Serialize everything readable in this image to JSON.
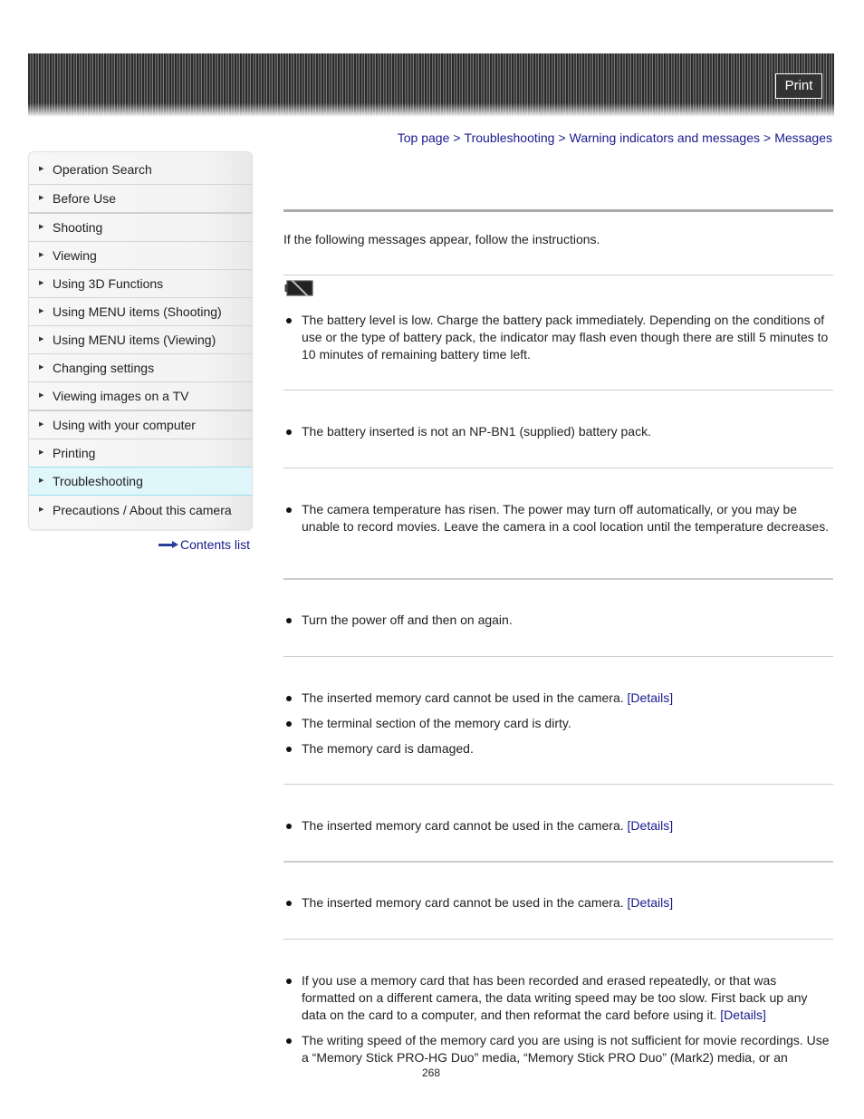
{
  "header": {
    "print_label": "Print"
  },
  "breadcrumb": {
    "items": [
      "Top page",
      "Troubleshooting",
      "Warning indicators and messages",
      "Messages"
    ],
    "separator": ">"
  },
  "sidebar": {
    "items": [
      {
        "label": "Operation Search"
      },
      {
        "label": "Before Use"
      },
      {
        "label": "Shooting"
      },
      {
        "label": "Viewing"
      },
      {
        "label": "Using 3D Functions"
      },
      {
        "label": "Using MENU items (Shooting)"
      },
      {
        "label": "Using MENU items (Viewing)"
      },
      {
        "label": "Changing settings"
      },
      {
        "label": "Viewing images on a TV"
      },
      {
        "label": "Using with your computer"
      },
      {
        "label": "Printing"
      },
      {
        "label": "Troubleshooting",
        "active": true
      },
      {
        "label": "Precautions / About this camera"
      }
    ],
    "arrow_glyph": "▶",
    "contents_link": "Contents list"
  },
  "main": {
    "intro": "If the following messages appear, follow the instructions.",
    "sections": [
      {
        "icon": "battery-low-icon",
        "bullets": [
          {
            "text": "The battery level is low. Charge the battery pack immediately. Depending on the conditions of use or the type of battery pack, the indicator may flash even though there are still 5 minutes to 10 minutes of remaining battery time left."
          }
        ]
      },
      {
        "bullets": [
          {
            "text": "The battery inserted is not an NP-BN1 (supplied) battery pack."
          }
        ]
      },
      {
        "bullets": [
          {
            "text": "The camera temperature has risen. The power may turn off automatically, or you may be unable to record movies. Leave the camera in a cool location until the temperature decreases."
          }
        ]
      },
      {
        "bullets": [
          {
            "text": "Turn the power off and then on again."
          }
        ]
      },
      {
        "bullets": [
          {
            "text": "The inserted memory card cannot be used in the camera.",
            "link": "[Details]"
          },
          {
            "text": "The terminal section of the memory card is dirty."
          },
          {
            "text": "The memory card is damaged."
          }
        ]
      },
      {
        "bullets": [
          {
            "text": "The inserted memory card cannot be used in the camera.",
            "link": "[Details]"
          }
        ]
      },
      {
        "bullets": [
          {
            "text": "The inserted memory card cannot be used in the camera.",
            "link": "[Details]"
          }
        ]
      },
      {
        "bullets": [
          {
            "text": "If you use a memory card that has been recorded and erased repeatedly, or that was formatted on a different camera, the data writing speed may be too slow. First back up any data on the card to a computer, and then reformat the card before using it.",
            "link": "[Details]"
          },
          {
            "text": "The writing speed of the memory card you are using is not sufficient for movie recordings. Use a “Memory Stick PRO-HG Duo” media, “Memory Stick PRO Duo” (Mark2) media, or an"
          }
        ]
      }
    ]
  },
  "footer": {
    "page_number": "268"
  },
  "colors": {
    "link": "#1a1a8c",
    "active_sidebar_bg": "#dff6fa",
    "active_sidebar_border": "#9adfee"
  }
}
